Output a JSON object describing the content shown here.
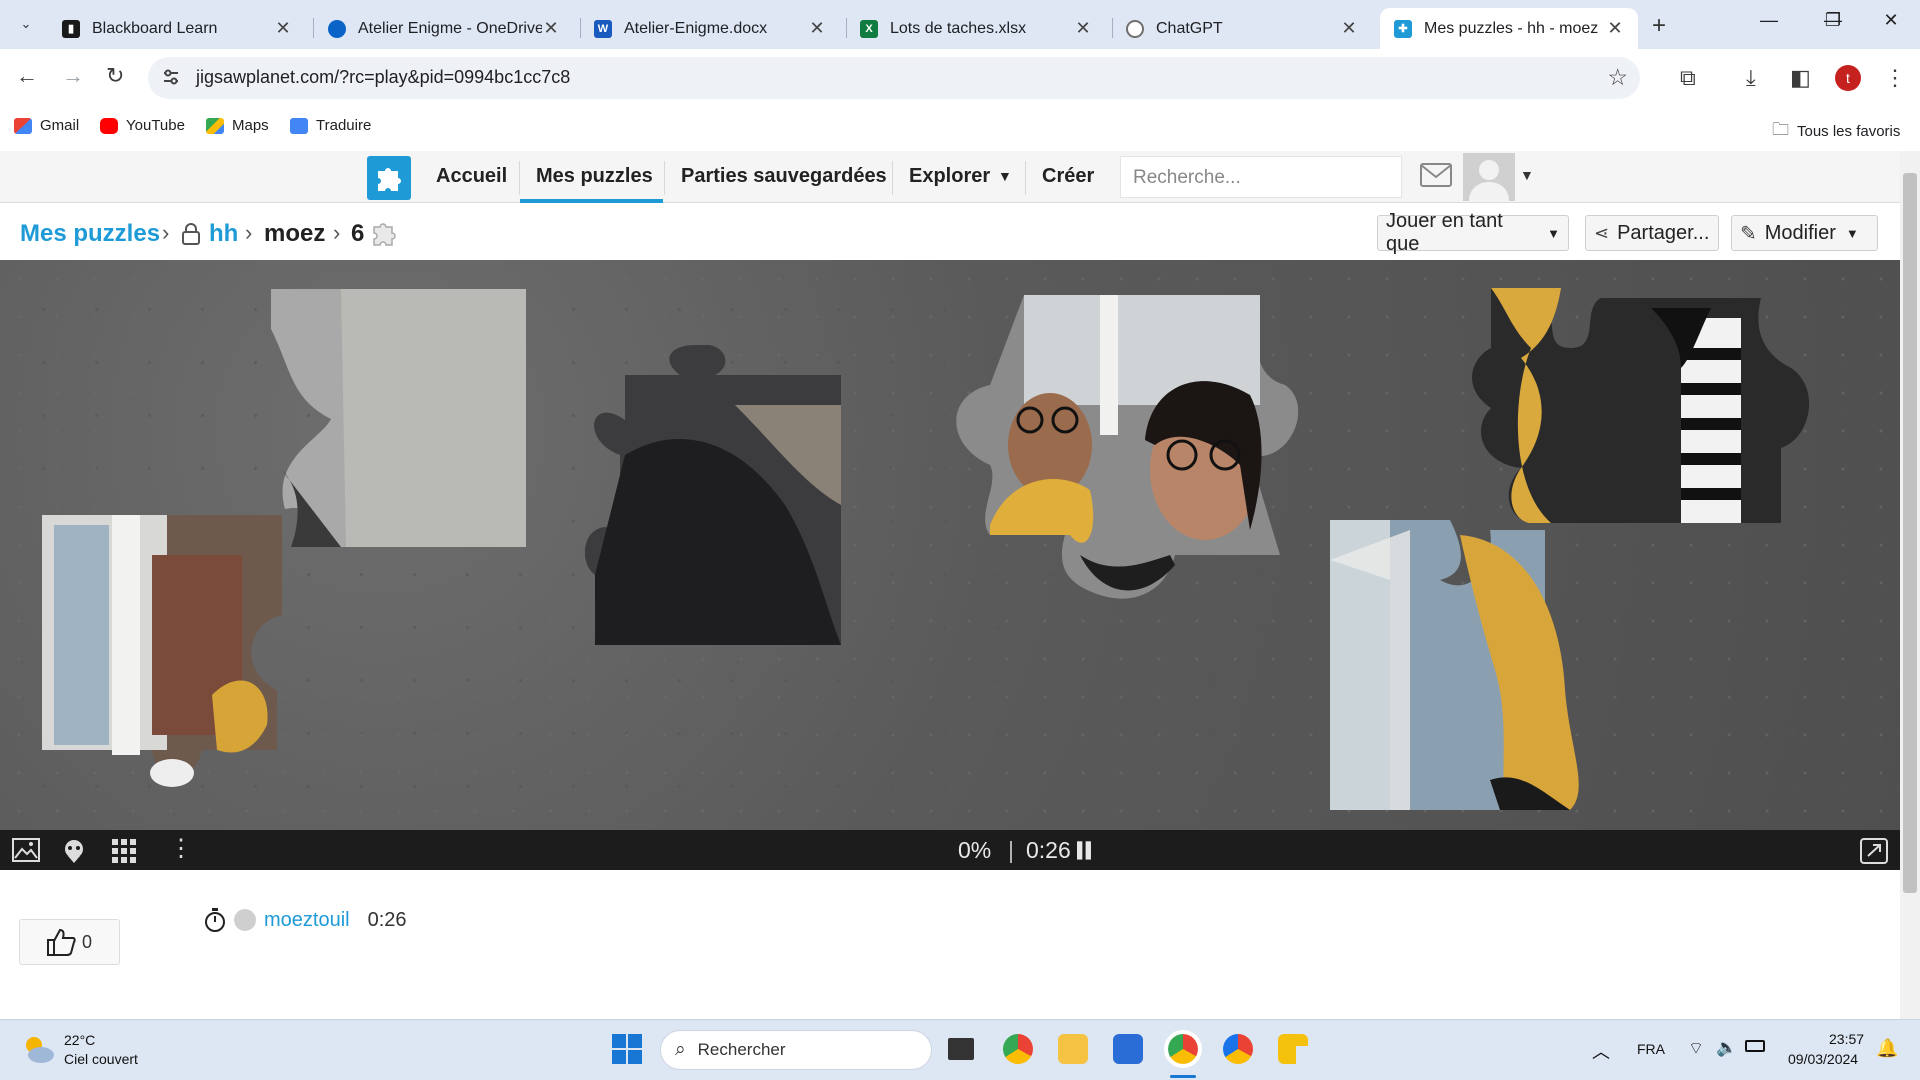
{
  "browser": {
    "tabs": [
      {
        "title": "Blackboard Learn",
        "icon": "blackboard-icon",
        "color": "#1a1a1a"
      },
      {
        "title": "Atelier Enigme - OneDrive",
        "icon": "onedrive-icon",
        "color": "#0a64c8"
      },
      {
        "title": "Atelier-Enigme.docx",
        "icon": "word-icon",
        "color": "#185abd"
      },
      {
        "title": "Lots de taches.xlsx",
        "icon": "excel-icon",
        "color": "#107c41"
      },
      {
        "title": "ChatGPT",
        "icon": "chatgpt-icon",
        "color": "#6f6f6f"
      },
      {
        "title": "Mes puzzles - hh - moez",
        "icon": "jigsaw-icon",
        "color": "#1e9bd7"
      }
    ],
    "url": "jigsawplanet.com/?rc=play&pid=0994bc1cc7c8",
    "profile_initial": "t",
    "bookmarks": [
      {
        "label": "Gmail",
        "icon": "gmail-icon"
      },
      {
        "label": "YouTube",
        "icon": "youtube-icon"
      },
      {
        "label": "Maps",
        "icon": "maps-icon"
      },
      {
        "label": "Traduire",
        "icon": "translate-icon"
      }
    ],
    "all_bookmarks": "Tous les favoris"
  },
  "site": {
    "nav": [
      "Accueil",
      "Mes puzzles",
      "Parties sauvegardées",
      "Explorer",
      "Créer"
    ],
    "active_nav": "Mes puzzles",
    "search_placeholder": "Recherche...",
    "breadcrumb": {
      "root": "Mes puzzles",
      "folder": "hh",
      "puzzle": "moez",
      "pieces": "6"
    },
    "buttons": {
      "play_as": "Jouer en tant que",
      "share": "Partager...",
      "edit": "Modifier"
    },
    "accent": "#1e9bd7"
  },
  "board": {
    "progress": "0%",
    "separator": "|",
    "timer": "0:26"
  },
  "below": {
    "likes": "0",
    "player": "moeztouil",
    "player_time": "0:26"
  },
  "taskbar": {
    "temperature": "22°C",
    "weather": "Ciel couvert",
    "search": "Rechercher",
    "lang": "FRA",
    "time": "23:57",
    "date": "09/03/2024"
  }
}
